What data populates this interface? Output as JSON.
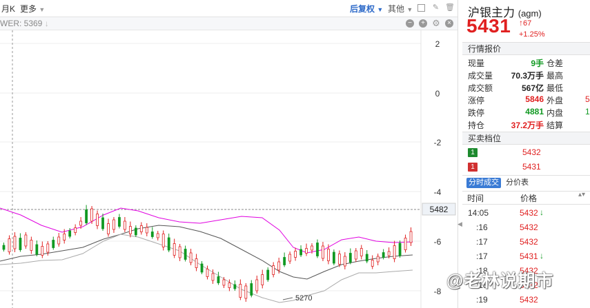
{
  "toolbar": {
    "tab_partial": "月K",
    "more_label": "更多",
    "adjust_label": "后复权",
    "other_label": "其他"
  },
  "indicator": {
    "label": "WER: 5369",
    "arrow": "↓"
  },
  "chart_data": {
    "type": "candlestick",
    "right_axis_ticks": [
      "2",
      "0",
      "-2",
      "-4",
      "-6",
      "-8"
    ],
    "current_price_label": "5482",
    "low_marker_label": "5270",
    "grid": true,
    "colors": {
      "up": "#e02020",
      "down": "#119922",
      "upper_band": "#e000e0",
      "mid_band": "#555555",
      "lower_band": "#aaaaaa"
    }
  },
  "quote": {
    "name": "沪银主力",
    "code": "(agm)",
    "price": "5431",
    "change": "67",
    "change_pct": "+1.25%"
  },
  "market_title": "行情报价",
  "market_rows": [
    {
      "label": "现量",
      "value": "9手",
      "label2": "仓差",
      "value2": ""
    },
    {
      "label": "成交量",
      "value": "70.3万手",
      "label2": "最高",
      "value2": ""
    },
    {
      "label": "成交额",
      "value": "567亿",
      "label2": "最低",
      "value2": ""
    },
    {
      "label": "涨停",
      "value": "5846",
      "label2": "外盘",
      "value2": "5"
    },
    {
      "label": "跌停",
      "value": "4881",
      "label2": "内盘",
      "value2": "1"
    },
    {
      "label": "持仓",
      "value": "37.2万手",
      "label2": "结算",
      "value2": ""
    }
  ],
  "orderbook_title": "买卖档位",
  "orderbook": [
    {
      "level": "1",
      "price": "5432",
      "side": "sell"
    },
    {
      "level": "1",
      "price": "5431",
      "side": "buy"
    }
  ],
  "tabs": {
    "trades": "分时成交",
    "price_table": "分价表"
  },
  "trade_headers": {
    "time": "时间",
    "price": "价格"
  },
  "trades": [
    {
      "time": "14:05",
      "price": "5432",
      "dir": "↓"
    },
    {
      "time": ":16",
      "price": "5432",
      "dir": ""
    },
    {
      "time": ":17",
      "price": "5432",
      "dir": ""
    },
    {
      "time": ":17",
      "price": "5431",
      "dir": "↓"
    },
    {
      "time": ":18",
      "price": "5432",
      "dir": ""
    },
    {
      "time": ":18",
      "price": "5432",
      "dir": ""
    },
    {
      "time": ":19",
      "price": "5432",
      "dir": ""
    }
  ],
  "watermark": "@老林说期市"
}
